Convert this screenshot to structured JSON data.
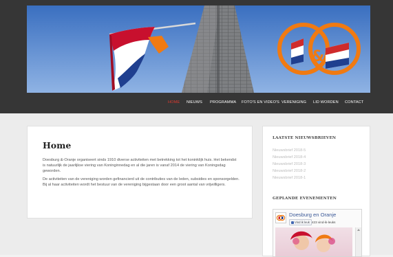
{
  "nav": {
    "items": [
      {
        "label": "HOME",
        "active": true
      },
      {
        "label": "NIEUWS"
      },
      {
        "label": "PROGRAMMA"
      },
      {
        "label": "FOTO'S EN VIDEO'S"
      },
      {
        "label": "VERENIGING"
      },
      {
        "label": "LID WORDEN"
      },
      {
        "label": "CONTACT"
      }
    ]
  },
  "logo": {
    "text": "&",
    "colors": {
      "orange": "#f07a12",
      "red": "#cf2b2b",
      "blue": "#1f3f8f"
    }
  },
  "main": {
    "title": "Home",
    "paragraphs": [
      "Doesburg &-Oranje organiseert sinds 1910 diverse activiteiten met betrekking tot het koninklijk huis. Het bekendst is natuurlijk de jaarlijkse viering van Koninginnedag en al die jaren is vanaf 2014 de viering van Koningsdag geworden.",
      "De activiteiten van de vereniging worden gefinancierd uit de contributies van de leden, subsidies en sponsorgelden. Bij al haar activiteiten wordt het bestuur van de vereniging bijgestaan door een groot aantal van vrijwilligers."
    ]
  },
  "sidebar": {
    "newsletters_heading": "LAATSTE NIEUWSBRIEVEN",
    "newsletters": [
      "Nieuwsbrief 2018-5",
      "Nieuwsbrief 2018-4",
      "Nieuwsbrief 2018-3",
      "Nieuwsbrief 2018-2",
      "Nieuwsbrief 2018-1"
    ],
    "events_heading": "GEPLANDE EVENEMENTEN",
    "facebook": {
      "page_name": "Doesburg en Oranje",
      "like_label": "Vind ik leuk",
      "like_count": "423 vind-ik-leuks"
    }
  },
  "colors": {
    "topbar": "#363636",
    "nav_active": "#e03a2f",
    "fb_blue": "#3b5998",
    "page_bg": "#ececec"
  }
}
